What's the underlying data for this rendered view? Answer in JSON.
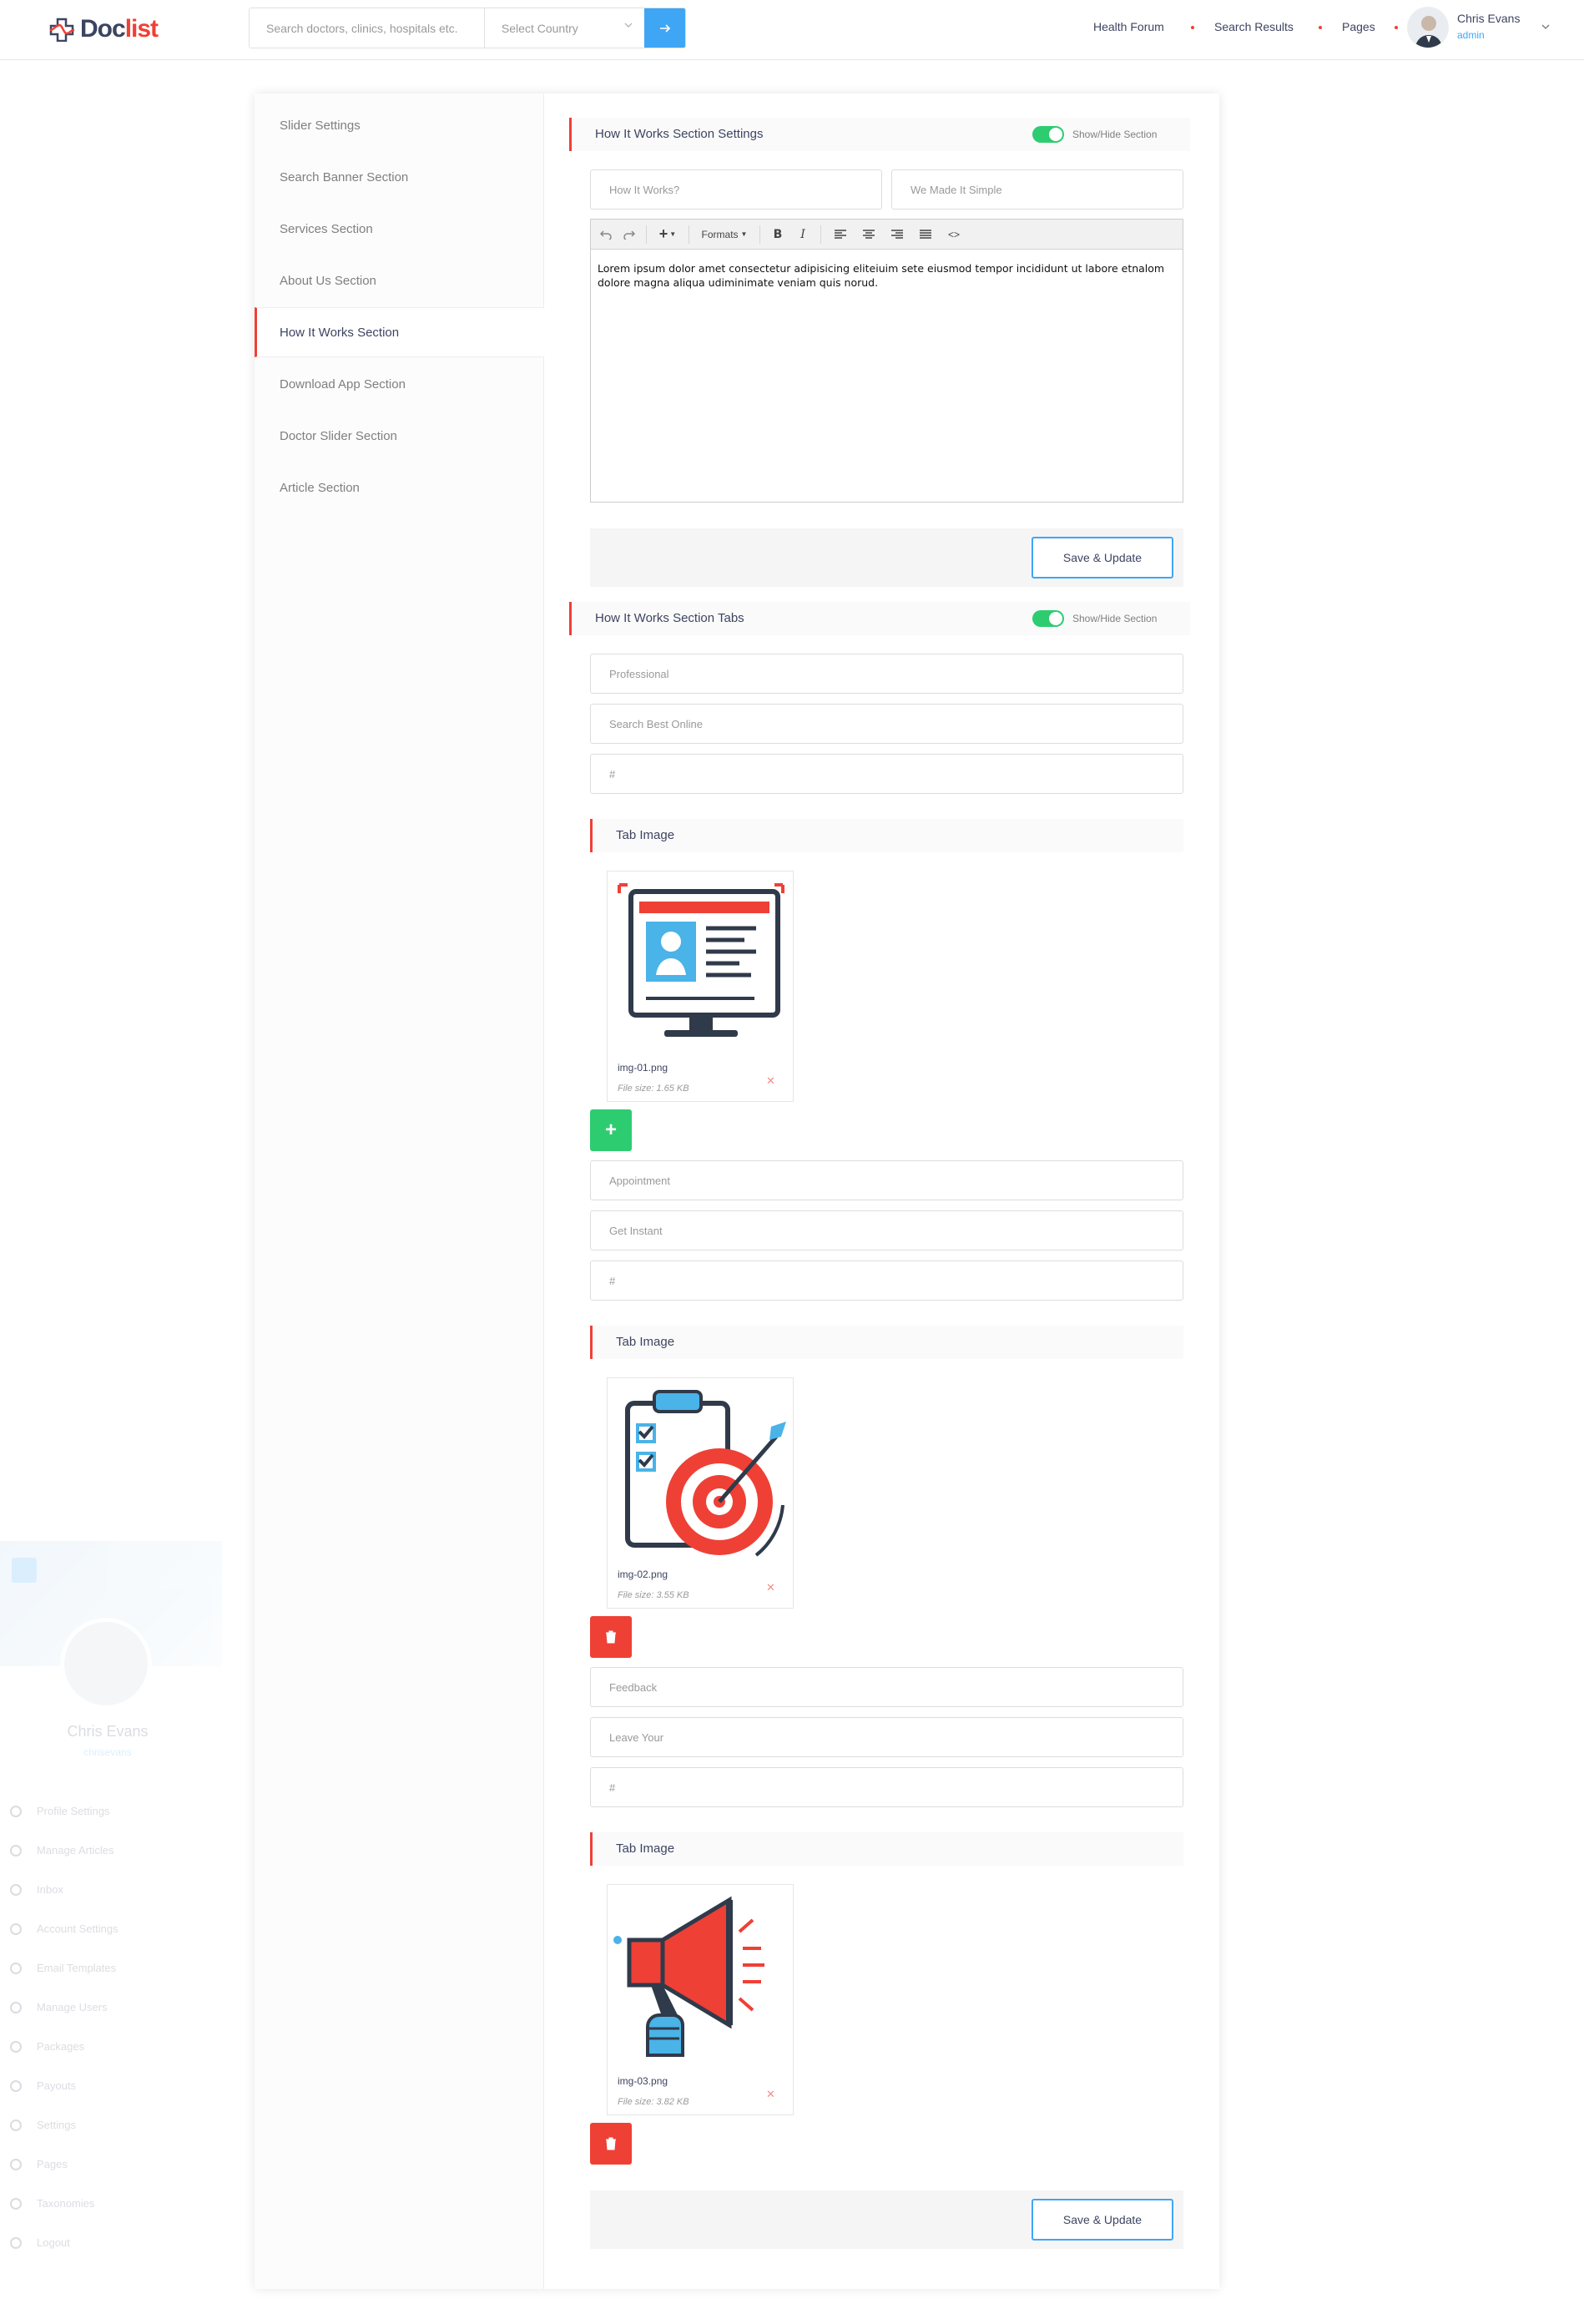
{
  "header": {
    "logo_part1": "Doc",
    "logo_part2": "list",
    "search_placeholder": "Search doctors, clinics, hospitals etc.",
    "country_placeholder": "Select Country",
    "nav": [
      "Health Forum",
      "Search Results",
      "Pages"
    ],
    "user_name": "Chris Evans",
    "user_role": "admin"
  },
  "sidebar_faded": {
    "name": "Chris Evans",
    "sub": "chrisevans",
    "menu": [
      "Profile Settings",
      "Manage Articles",
      "Inbox",
      "Account Settings",
      "Email Templates",
      "Manage Users",
      "Packages",
      "Payouts",
      "Settings",
      "Pages",
      "Taxonomies",
      "Logout"
    ]
  },
  "tabs": [
    "Slider Settings",
    "Search Banner Section",
    "Services Section",
    "About Us Section",
    "How It Works Section",
    "Download App Section",
    "Doctor Slider Section",
    "Article Section"
  ],
  "active_tab": "How It Works Section",
  "settings": {
    "title": "How It Works Section Settings",
    "toggle_label": "Show/Hide Section",
    "toggle_on": true,
    "field_title": "How It Works?",
    "field_subtitle": "We Made It Simple",
    "editor_formats": "Formats",
    "editor_text": "Lorem ipsum dolor amet consectetur adipisicing eliteiuim sete eiusmod tempor incididunt ut labore etnalom dolore magna aliqua udiminimate veniam quis norud.",
    "save_label": "Save & Update"
  },
  "tabs_section": {
    "title": "How It Works Section Tabs",
    "toggle_label": "Show/Hide Section",
    "toggle_on": true,
    "image_heading": "Tab Image",
    "items": [
      {
        "title": "Professional",
        "subtitle": "Search Best Online",
        "link": "#",
        "image_name": "img-01.png",
        "image_size": "File size: 1.65 KB",
        "action": "add"
      },
      {
        "title": "Appointment",
        "subtitle": "Get Instant",
        "link": "#",
        "image_name": "img-02.png",
        "image_size": "File size: 3.55 KB",
        "action": "delete"
      },
      {
        "title": "Feedback",
        "subtitle": "Leave Your",
        "link": "#",
        "image_name": "img-03.png",
        "image_size": "File size: 3.82 KB",
        "action": "delete"
      }
    ],
    "save_label": "Save & Update"
  },
  "colors": {
    "accent_red": "#ef4036",
    "accent_blue": "#3fa6f5",
    "toggle_green": "#2ecc71",
    "text_dark": "#3d4461"
  }
}
